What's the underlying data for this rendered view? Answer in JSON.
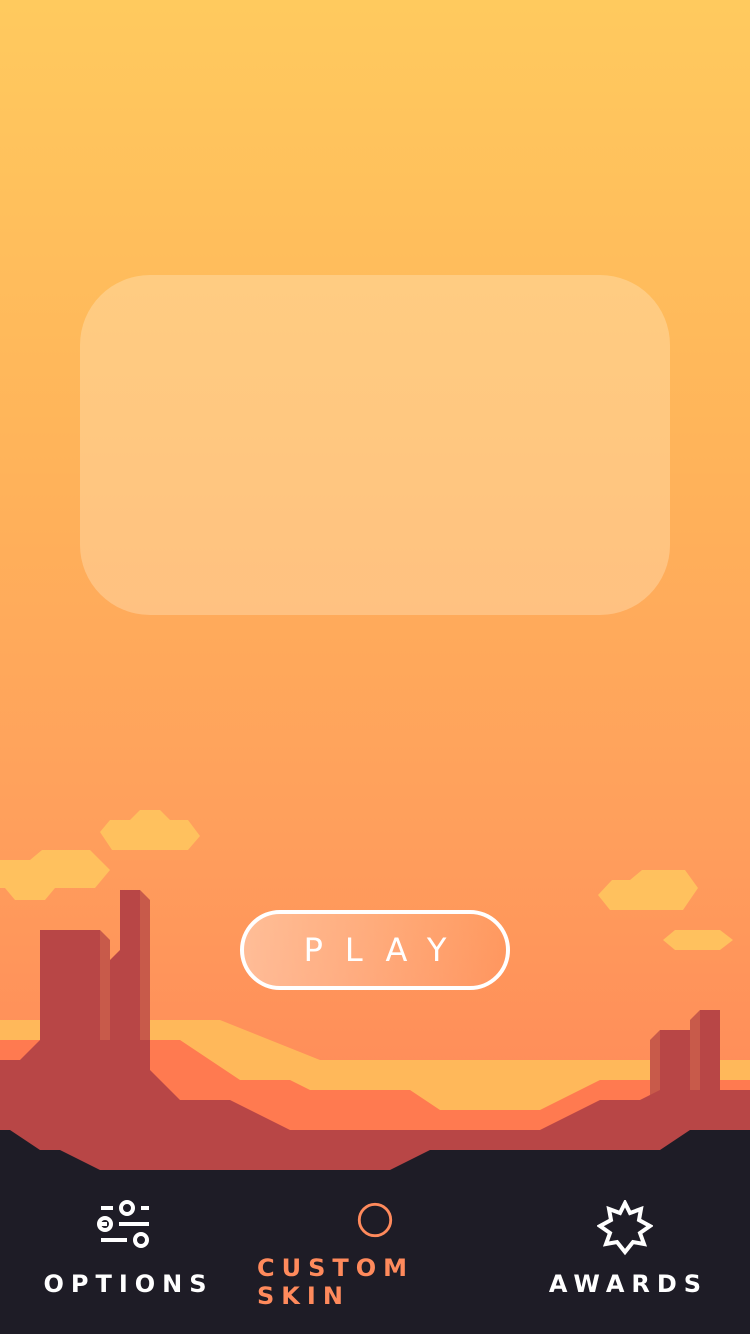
{
  "main": {
    "play_label": "PLAY"
  },
  "nav": {
    "options_label": "OPTIONS",
    "custom_skin_label": "CUSTOM SKIN",
    "awards_label": "AWARDS"
  },
  "colors": {
    "sky_top": "#ffca5e",
    "sky_bottom": "#ff8458",
    "accent": "#ff8a5c",
    "bottom_bar": "#1e1c26",
    "rock": "#b84646",
    "sand": "#ffb85a",
    "dune": "#ff7a50",
    "white": "#ffffff"
  },
  "icons": {
    "options": "sliders-icon",
    "custom_skin": "circle-icon",
    "awards": "badge-star-icon"
  }
}
